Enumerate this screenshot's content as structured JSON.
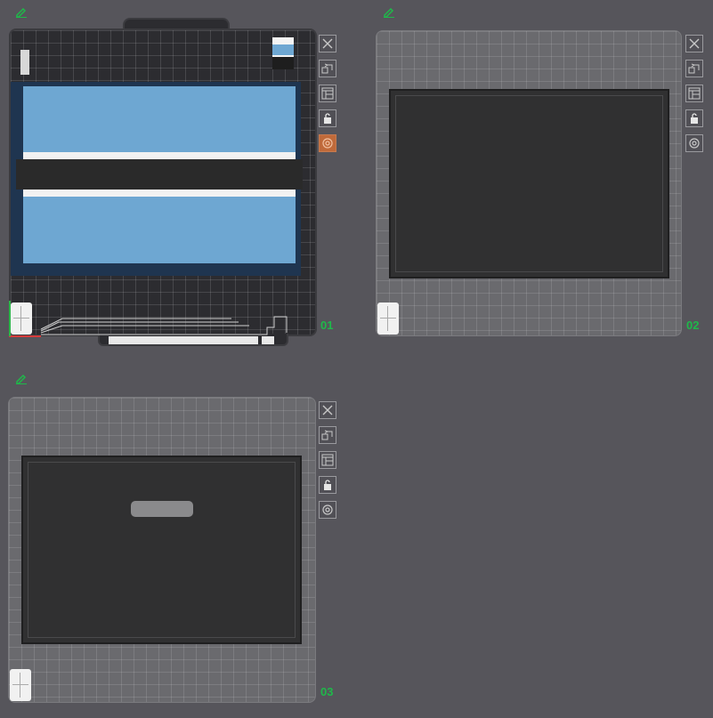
{
  "plates": [
    {
      "number": "01",
      "active": true
    },
    {
      "number": "02",
      "active": false
    },
    {
      "number": "03",
      "active": false
    }
  ],
  "flag_colors": {
    "blue": "#6ea7d2",
    "white": "#f2f2f2",
    "black": "#2a2a2a"
  },
  "accent_color": "#1fb84a",
  "icons": [
    "edit-icon",
    "close-icon",
    "auto-arrange-icon",
    "layout-icon",
    "lock-icon",
    "settings-icon"
  ]
}
